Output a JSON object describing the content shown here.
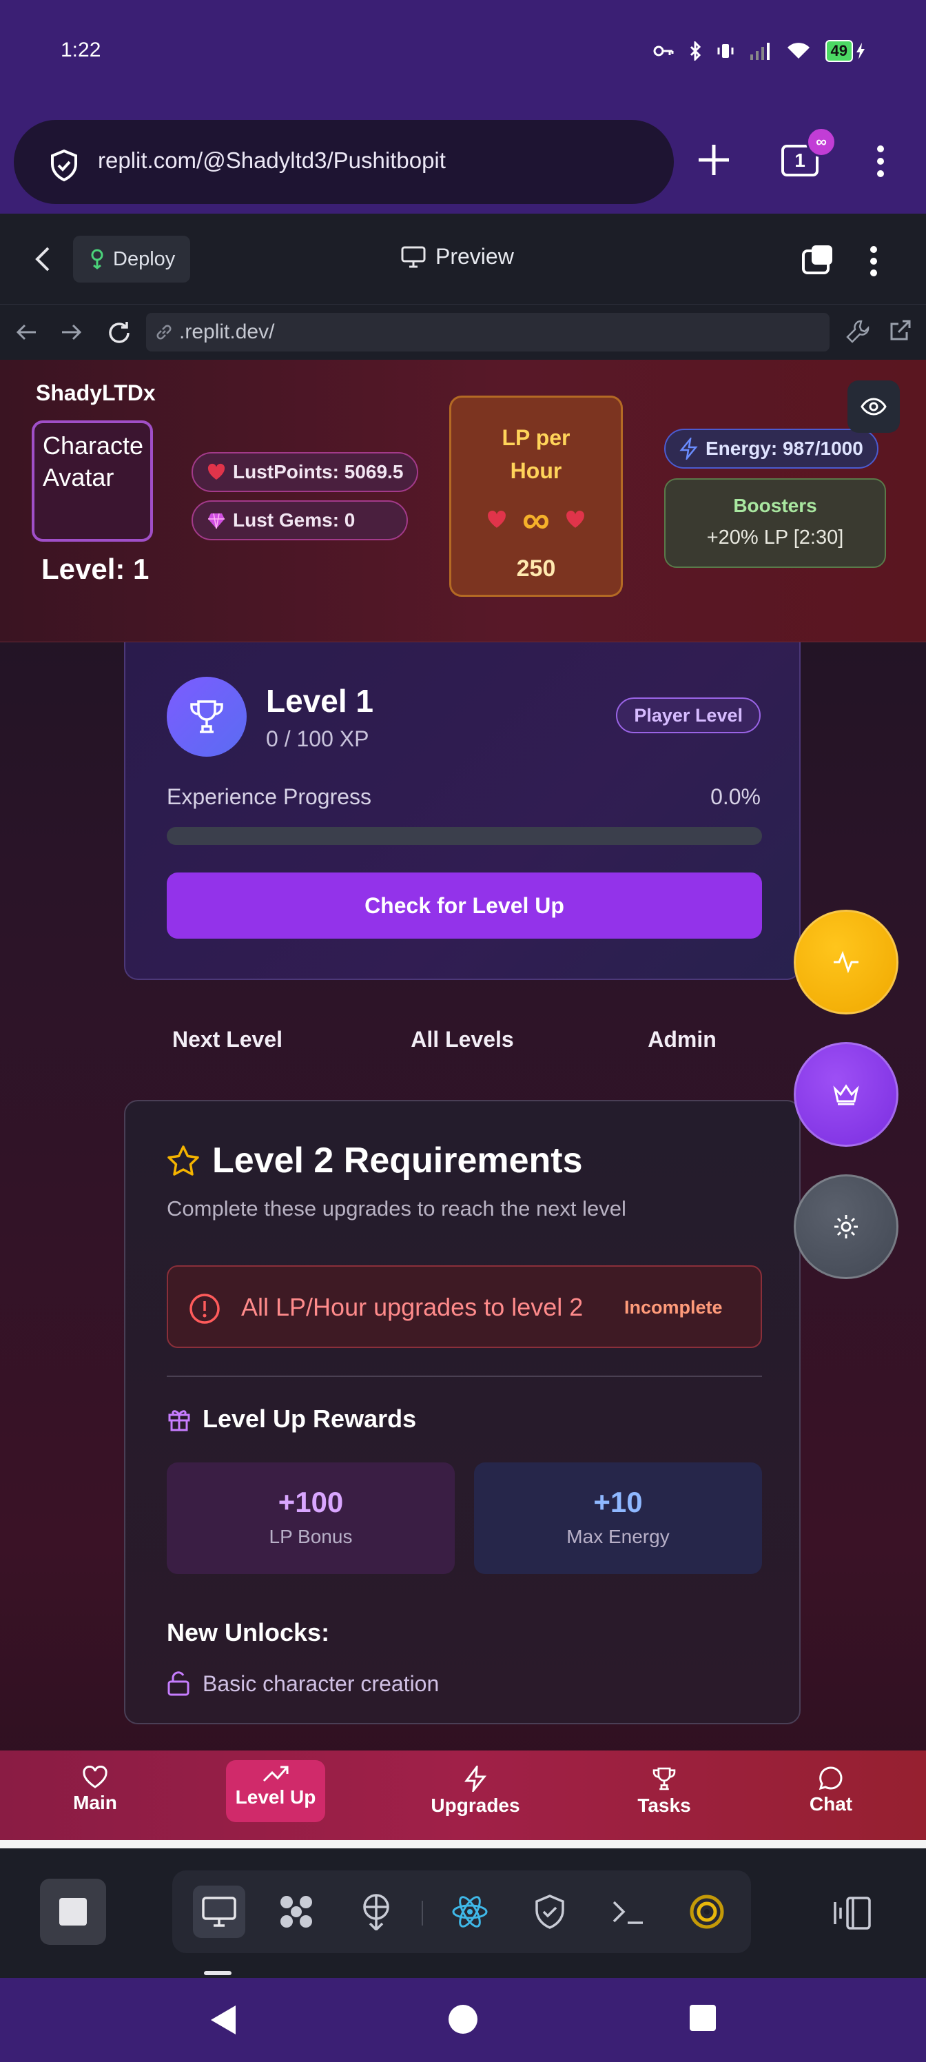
{
  "status_bar": {
    "time": "1:22",
    "battery": "49",
    "icons": [
      "key-icon",
      "bluetooth-icon",
      "vibrate-icon",
      "signal-icon",
      "wifi-icon",
      "battery-icon"
    ]
  },
  "browser": {
    "url": "replit.com/@Shadyltd3/Pushitbopit",
    "tab_count": "1",
    "tab_badge": "∞"
  },
  "replit_header": {
    "deploy_label": "Deploy",
    "preview_label": "Preview"
  },
  "webview": {
    "address": ".replit.dev/"
  },
  "player": {
    "username": "ShadyLTDx",
    "avatar_text_line1": "Characte",
    "avatar_text_line2": "Avatar",
    "level_label": "Level: 1",
    "lust_points": "LustPoints: 5069.5",
    "lust_gems": "Lust Gems: 0",
    "lp_per_hour_title_line1": "LP per",
    "lp_per_hour_title_line2": "Hour",
    "lp_per_hour_symbol": "∞",
    "lp_per_hour_value": "250",
    "energy": "Energy: 987/1000",
    "boosters_title": "Boosters",
    "boosters_value": "+20% LP [2:30]"
  },
  "level_card": {
    "title": "Level 1",
    "xp": "0 / 100 XP",
    "badge": "Player Level",
    "progress_label": "Experience Progress",
    "progress_pct": "0.0%",
    "progress_fraction": 0.0,
    "check_button": "Check for Level Up"
  },
  "level_tabs": [
    "Next Level",
    "All Levels",
    "Admin"
  ],
  "requirements": {
    "title": "Level 2 Requirements",
    "subtitle": "Complete these upgrades to reach the next level",
    "item_text": "All LP/Hour upgrades to level 2",
    "item_status": "Incomplete",
    "rewards_title": "Level Up Rewards",
    "rewards": [
      {
        "value": "+100",
        "label": "LP Bonus",
        "color": "#d9a6ff"
      },
      {
        "value": "+10",
        "label": "Max Energy",
        "color": "#8fb8ff"
      }
    ],
    "unlocks_title": "New Unlocks:",
    "unlock_item": "Basic character creation"
  },
  "fabs": [
    {
      "name": "activity-icon",
      "color": "#f5b400"
    },
    {
      "name": "crown-icon",
      "color": "#8b3fe8"
    },
    {
      "name": "settings-icon",
      "color": "#4a505c"
    }
  ],
  "bottom_nav": [
    {
      "label": "Main",
      "icon": "heart-icon"
    },
    {
      "label": "Level Up",
      "icon": "trending-up-icon",
      "active": true
    },
    {
      "label": "Upgrades",
      "icon": "zap-icon"
    },
    {
      "label": "Tasks",
      "icon": "trophy-icon"
    },
    {
      "label": "Chat",
      "icon": "chat-icon"
    }
  ],
  "colors": {
    "accent_purple": "#9333ea",
    "lp_gold": "#f5b12a",
    "error_red": "#ff8b8b"
  }
}
